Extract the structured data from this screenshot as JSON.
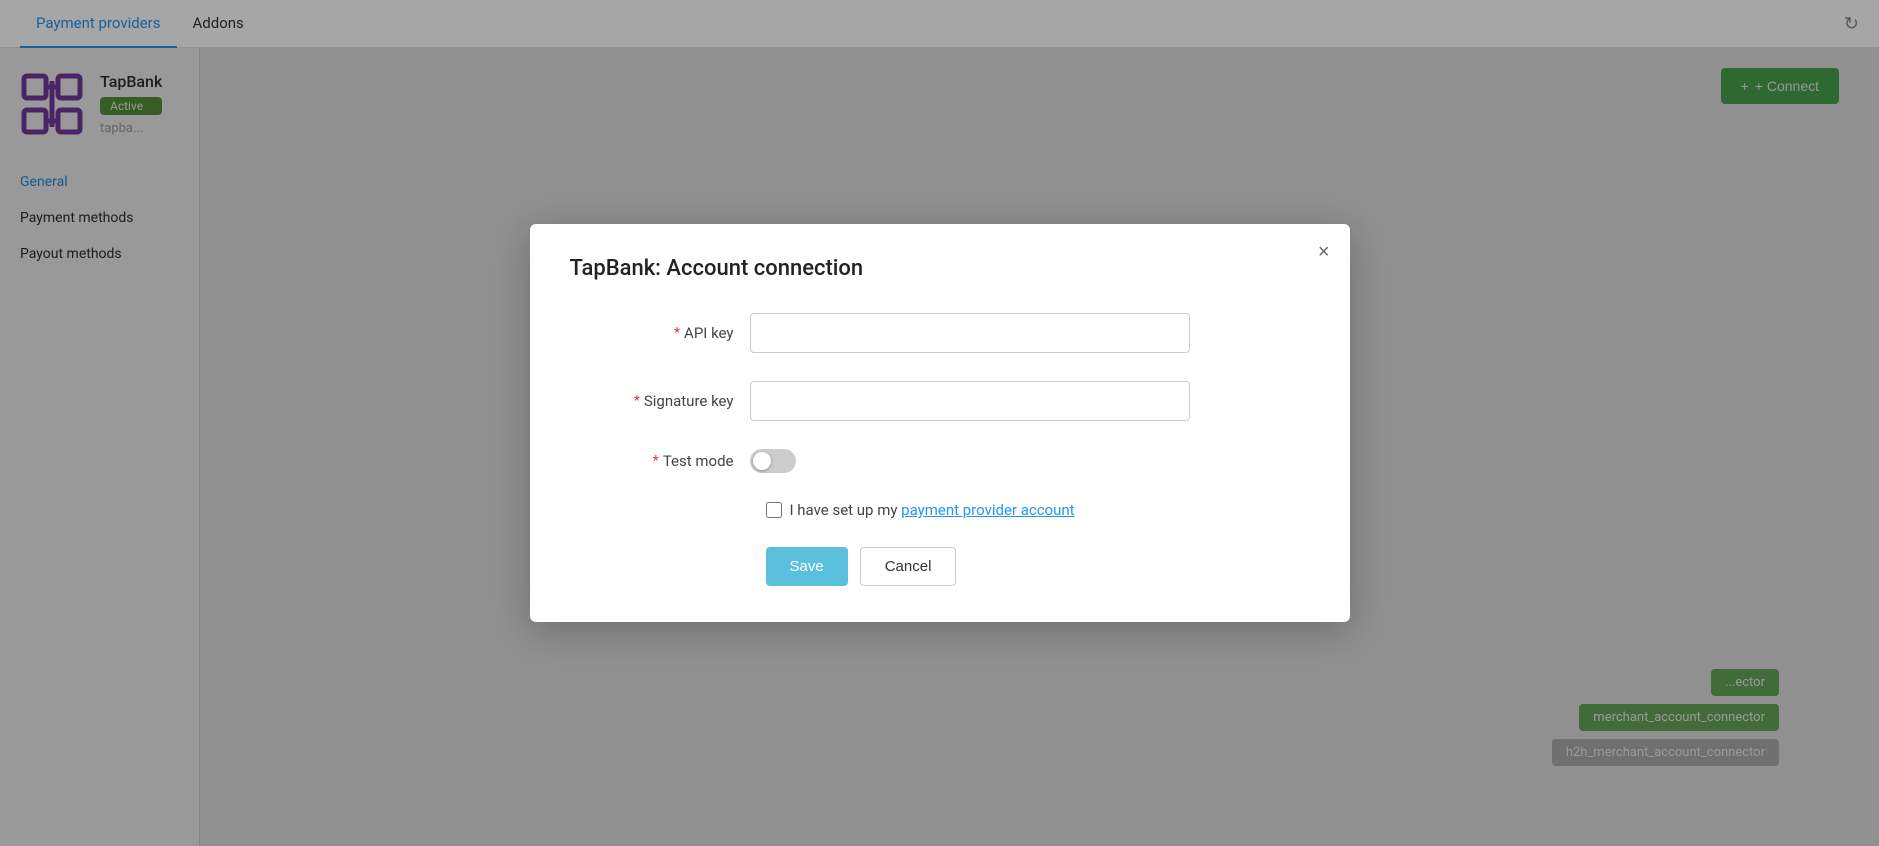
{
  "tabs": [
    {
      "id": "payment-providers",
      "label": "Payment providers",
      "active": true
    },
    {
      "id": "addons",
      "label": "Addons",
      "active": false
    }
  ],
  "sidebar": {
    "brand": {
      "name": "TapBank",
      "status": "Active",
      "url": "tapba..."
    },
    "nav": [
      {
        "id": "general",
        "label": "General",
        "active": true
      },
      {
        "id": "payment-methods",
        "label": "Payment methods",
        "active": false
      },
      {
        "id": "payout-methods",
        "label": "Payout methods",
        "active": false
      }
    ]
  },
  "header": {
    "connect_button": "+ Connect"
  },
  "chips": [
    {
      "label": "...ector",
      "style": "green"
    },
    {
      "label": "merchant_account_connector",
      "style": "green"
    },
    {
      "label": "h2h_merchant_account_connector",
      "style": "gray"
    }
  ],
  "modal": {
    "title": "TapBank: Account connection",
    "close_label": "×",
    "fields": [
      {
        "id": "api-key",
        "label": "API key",
        "required": true,
        "placeholder": "",
        "type": "text"
      },
      {
        "id": "signature-key",
        "label": "Signature key",
        "required": true,
        "placeholder": "",
        "type": "text"
      },
      {
        "id": "test-mode",
        "label": "Test mode",
        "required": true,
        "type": "toggle",
        "value": false
      }
    ],
    "checkbox": {
      "label_prefix": "I have set up my ",
      "link_text": "payment provider account",
      "link_url": "#"
    },
    "buttons": {
      "save": "Save",
      "cancel": "Cancel"
    }
  },
  "icons": {
    "refresh": "↻",
    "plus": "+"
  },
  "colors": {
    "active_tab": "#2196f3",
    "active_badge": "#5a9e3a",
    "connect_btn": "#4caf50",
    "save_btn": "#5bc0de",
    "link": "#2196f3",
    "required": "#e53935",
    "chip_green": "#6db560"
  }
}
